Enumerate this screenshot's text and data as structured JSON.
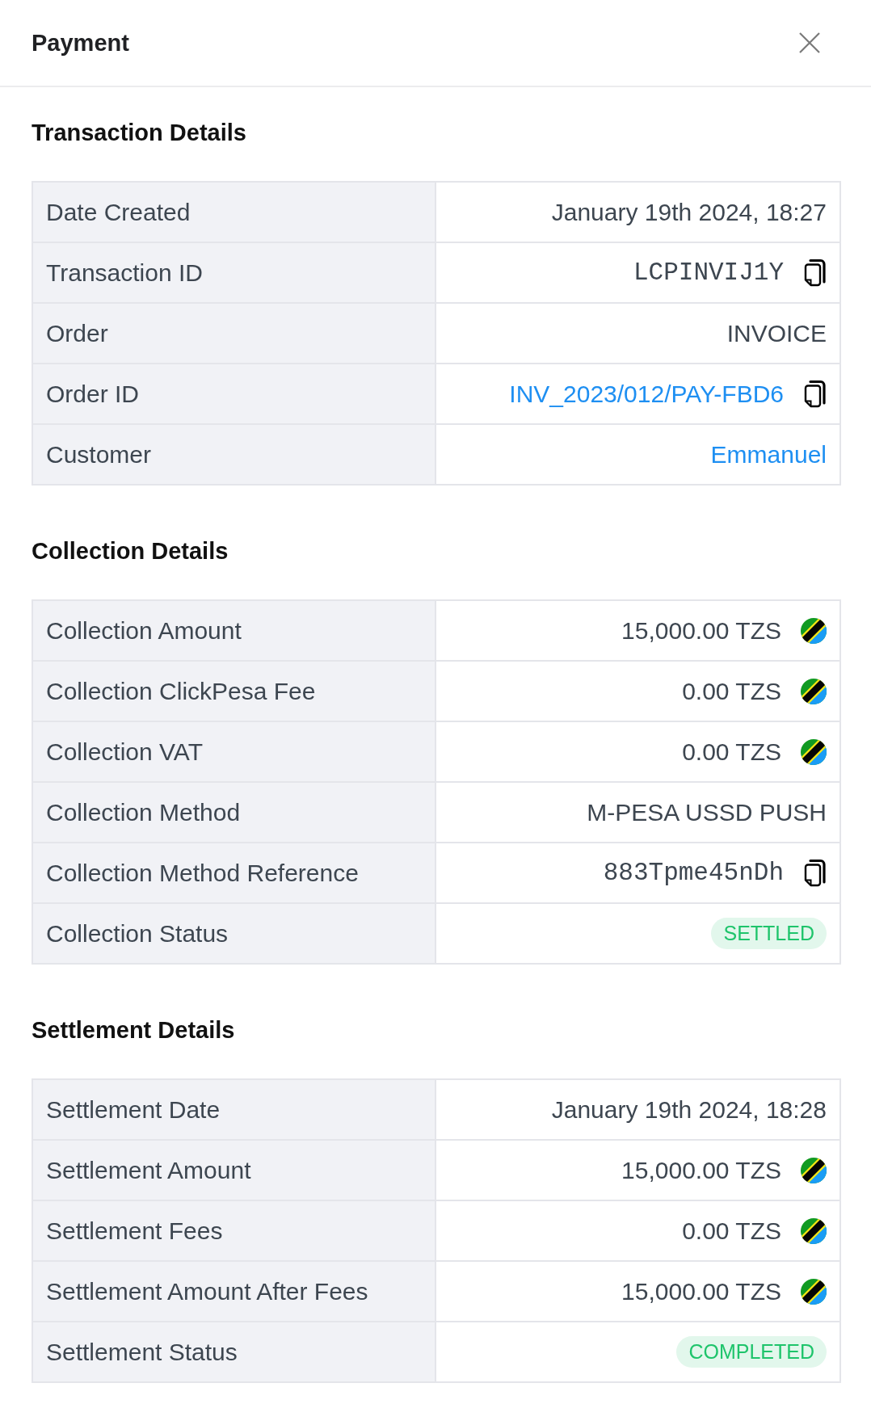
{
  "header": {
    "title": "Payment"
  },
  "sections": [
    {
      "title": "Transaction Details",
      "rows": [
        {
          "label": "Date Created",
          "value": "January 19th 2024, 18:27",
          "kind": "text",
          "copyable": false
        },
        {
          "label": "Transaction ID",
          "value": "LCPINVIJ1Y",
          "kind": "mono",
          "copyable": true
        },
        {
          "label": "Order",
          "value": "INVOICE",
          "kind": "text",
          "copyable": false
        },
        {
          "label": "Order ID",
          "value": "INV_2023/012/PAY-FBD6",
          "kind": "link",
          "copyable": true
        },
        {
          "label": "Customer",
          "value": "Emmanuel",
          "kind": "link",
          "copyable": false
        }
      ]
    },
    {
      "title": "Collection Details",
      "rows": [
        {
          "label": "Collection Amount",
          "value": "15,000.00 TZS",
          "kind": "amount",
          "copyable": false
        },
        {
          "label": "Collection ClickPesa Fee",
          "value": "0.00 TZS",
          "kind": "amount",
          "copyable": false
        },
        {
          "label": "Collection VAT",
          "value": "0.00 TZS",
          "kind": "amount",
          "copyable": false
        },
        {
          "label": "Collection Method",
          "value": "M-PESA USSD PUSH",
          "kind": "text",
          "copyable": false
        },
        {
          "label": "Collection Method Reference",
          "value": "883Tpme45nDh",
          "kind": "mono",
          "copyable": true
        },
        {
          "label": "Collection Status",
          "value": "SETTLED",
          "kind": "status",
          "copyable": false
        }
      ]
    },
    {
      "title": "Settlement Details",
      "rows": [
        {
          "label": "Settlement Date",
          "value": "January 19th 2024, 18:28",
          "kind": "text",
          "copyable": false
        },
        {
          "label": "Settlement Amount",
          "value": "15,000.00 TZS",
          "kind": "amount",
          "copyable": false
        },
        {
          "label": "Settlement Fees",
          "value": "0.00 TZS",
          "kind": "amount",
          "copyable": false
        },
        {
          "label": "Settlement Amount After Fees",
          "value": "15,000.00 TZS",
          "kind": "amount",
          "copyable": false
        },
        {
          "label": "Settlement Status",
          "value": "COMPLETED",
          "kind": "status",
          "copyable": false
        }
      ]
    }
  ]
}
